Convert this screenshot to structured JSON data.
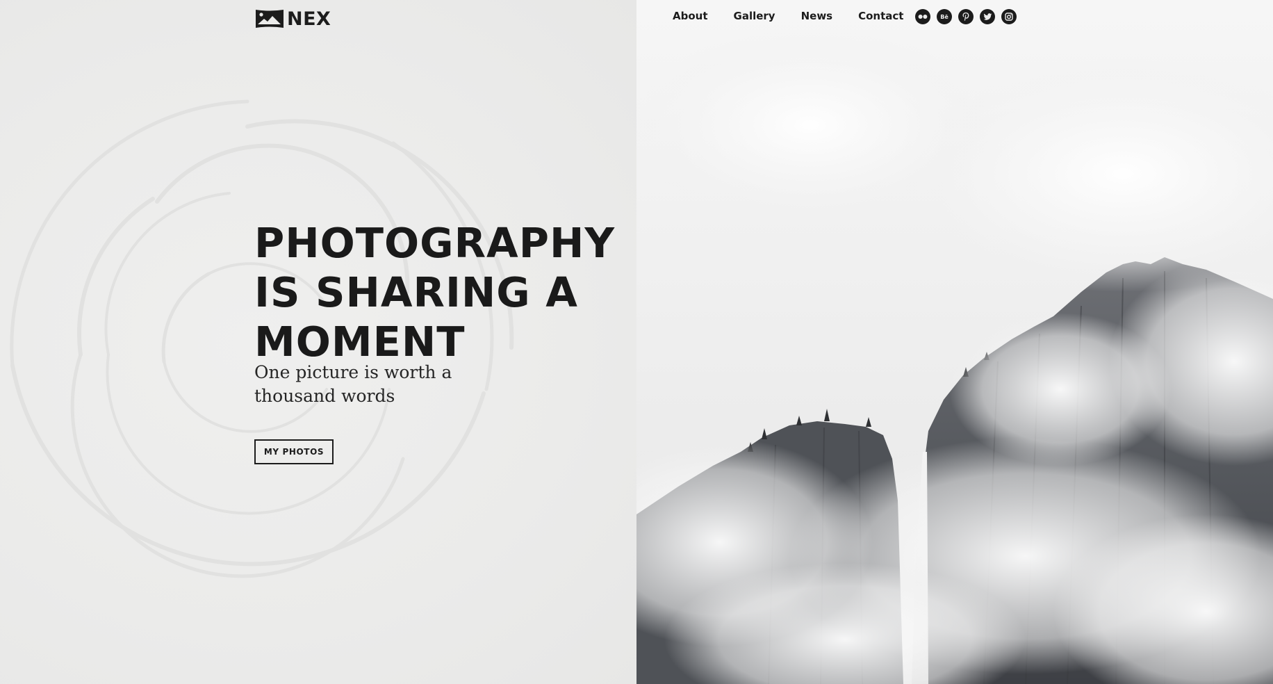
{
  "brand": {
    "name": "NEX",
    "logo_icon": "mountain-photo-icon"
  },
  "nav": {
    "items": [
      {
        "label": "About"
      },
      {
        "label": "Gallery"
      },
      {
        "label": "News"
      },
      {
        "label": "Contact"
      }
    ]
  },
  "social": [
    {
      "icon": "flickr-icon"
    },
    {
      "icon": "behance-icon",
      "glyph": "Bē"
    },
    {
      "icon": "pinterest-icon"
    },
    {
      "icon": "twitter-icon"
    },
    {
      "icon": "instagram-icon"
    }
  ],
  "hero": {
    "title": "PHOTOGRAPHY IS SHARING A MOMENT",
    "subtitle": "One picture is worth a thousand words",
    "cta_label": "MY PHOTOS"
  },
  "colors": {
    "text": "#1c1c1c",
    "left_background": "#ececeb",
    "accent_dark": "#1c1c1c"
  }
}
